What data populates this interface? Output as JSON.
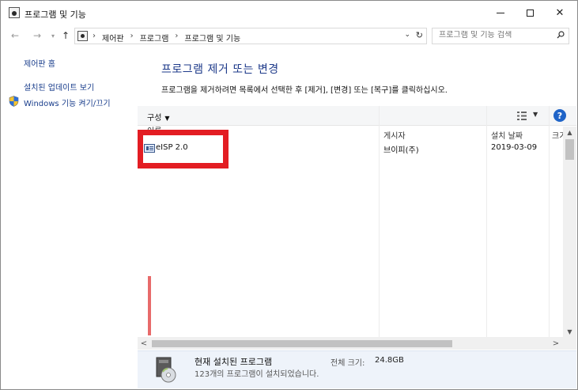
{
  "window": {
    "title": "프로그램 및 기능",
    "minimize_icon": "minimize-icon",
    "maximize_icon": "maximize-icon",
    "close_glyph": "✕"
  },
  "nav": {
    "back_glyph": "←",
    "forward_glyph": "→",
    "history_glyph": "▾",
    "up_glyph": "↑",
    "breadcrumbs": [
      "제어판",
      "프로그램",
      "프로그램 및 기능"
    ],
    "separator": "›",
    "dropdown_glyph": "⌄",
    "refresh_glyph": "↻"
  },
  "search": {
    "placeholder": "프로그램 및 기능 검색"
  },
  "sidebar": {
    "items": [
      {
        "label": "제어판 홈"
      },
      {
        "label": "설치된 업데이트 보기"
      },
      {
        "label": "Windows 기능 켜기/끄기",
        "icon": "shield-icon"
      }
    ]
  },
  "main": {
    "title": "프로그램 제거 또는 변경",
    "description": "프로그램을 제거하려면 목록에서 선택한 후 [제거], [변경] 또는 [복구]를 클릭하십시오."
  },
  "toolbar": {
    "organize_label": "구성",
    "caret": "▼",
    "help_glyph": "?"
  },
  "table": {
    "columns": [
      "이름",
      "게시자",
      "설치 날짜",
      "크기"
    ],
    "rows": [
      {
        "name": "eISP 2.0",
        "publisher": "브이피(주)",
        "install_date": "2019-03-09"
      }
    ]
  },
  "scroll": {
    "up": "▲",
    "down": "▼",
    "left": "<",
    "right": ">"
  },
  "details": {
    "title": "현재 설치된 프로그램",
    "size_label": "전체 크기:",
    "size_value": "24.8GB",
    "count_text": "123개의 프로그램이 설치되었습니다."
  },
  "colors": {
    "link": "#1a3e8c",
    "title": "#1e3a8a",
    "highlight": "#e31d23",
    "help": "#1f64c8"
  }
}
